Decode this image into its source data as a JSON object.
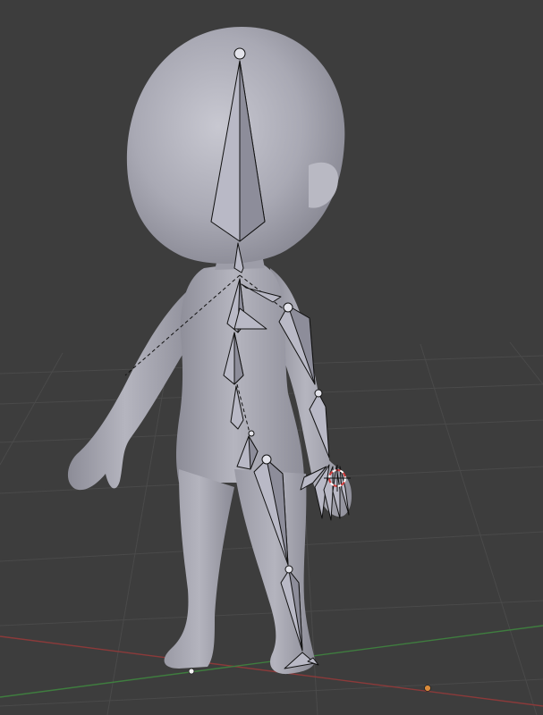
{
  "viewport": {
    "background": "#3d3d3d",
    "grid_color": "#4a4a4a",
    "x_axis_color": "#8b3a3a",
    "y_axis_color": "#3f7d3f"
  },
  "model": {
    "body_color": "#a9a9b4",
    "body_shade": "#8e8e99",
    "body_highlight": "#c6c6cf"
  },
  "armature": {
    "bone_fill": "#b9b9c6",
    "bone_fill_dark": "#8d8d9a",
    "bone_stroke": "#111111"
  },
  "gizmos": {
    "cursor_3d": "3d-cursor-icon",
    "origin_marker": "object-origin-icon",
    "light_marker": "light-origin-icon",
    "origin_color": "#d98a3a"
  }
}
